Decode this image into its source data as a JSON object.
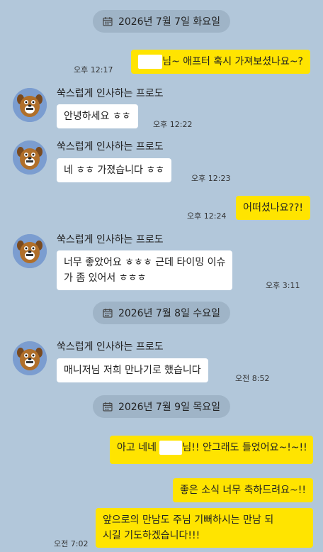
{
  "dates": [
    {
      "label": "2026년 7월 7일 화요일"
    },
    {
      "label": "2026년 7월 8일 수요일"
    },
    {
      "label": "2026년 7월 9일 목요일"
    }
  ],
  "sender_name": "쑥스럽게 인사하는 프로도",
  "messages": [
    {
      "text": "님~ 애프터 혹시 가져보셨나요~?",
      "time": "오후 12:17"
    },
    {
      "text": "안녕하세요 ㅎㅎ",
      "time": "오후 12:22"
    },
    {
      "text": "네 ㅎㅎ 가졌습니다 ㅎㅎ",
      "time": "오후 12:23"
    },
    {
      "text": "어떠셨나요??!",
      "time": "오후 12:24"
    },
    {
      "line1": "너무 좋았어요 ㅎㅎㅎ 근데 타이밍 이슈",
      "line2": "가 좀 있어서 ㅎㅎㅎ",
      "time": "오후 3:11"
    },
    {
      "text": "매니저님 저희 만나기로 했습니다",
      "time": "오전 8:52"
    },
    {
      "prefix": "아고 네네 ",
      "suffix": "님!! 안그래도 들었어요~!~!!"
    },
    {
      "text": "좋은 소식 너무 축하드려요~!!"
    },
    {
      "line1": "앞으로의 만남도 주님 기뻐하시는 만남 되",
      "line2": "시길 기도하겠습니다!!!",
      "time": "오전 7:02"
    }
  ],
  "colors": {
    "background": "#b2c7da",
    "outgoing": "#ffe400",
    "incoming": "#ffffff"
  }
}
